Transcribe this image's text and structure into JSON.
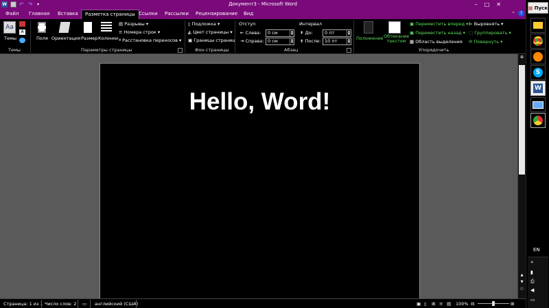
{
  "window": {
    "title": "Документ3 - Microsoft Word"
  },
  "tabs": [
    {
      "label": "Файл"
    },
    {
      "label": "Главная"
    },
    {
      "label": "Вставка"
    },
    {
      "label": "Разметка страницы",
      "active": true
    },
    {
      "label": "Ссылки"
    },
    {
      "label": "Рассылки"
    },
    {
      "label": "Рецензирование"
    },
    {
      "label": "Вид"
    }
  ],
  "ribbon": {
    "themes": {
      "themes_label": "Темы",
      "group_label": "Темы"
    },
    "page_setup": {
      "margins": "Поля",
      "orientation": "Ориентация",
      "size": "Размер",
      "columns": "Колонки",
      "breaks": "Разрывы",
      "line_numbers": "Номера строк",
      "hyphenation": "Расстановка переносов",
      "group_label": "Параметры страницы"
    },
    "page_background": {
      "watermark": "Подложка",
      "page_color": "Цвет страницы",
      "page_borders": "Границы страниц",
      "group_label": "Фон страницы"
    },
    "paragraph": {
      "indent_label": "Отступ",
      "left_label": "Слева:",
      "left_value": "0 см",
      "right_label": "Справа:",
      "right_value": "0 см",
      "spacing_label": "Интервал",
      "before_label": "До:",
      "before_value": "0 пт",
      "after_label": "После:",
      "after_value": "10 пт",
      "group_label": "Абзац"
    },
    "arrange": {
      "position": "Положение",
      "wrap_text_1": "Обтекание",
      "wrap_text_2": "текстом",
      "bring_forward": "Переместить вперед",
      "send_backward": "Переместить назад",
      "selection_pane": "Область выделения",
      "align": "Выровнять",
      "group": "Группировать",
      "rotate": "Повернуть",
      "group_label": "Упорядочить"
    }
  },
  "document": {
    "heading": "Hello, Word!"
  },
  "statusbar": {
    "page": "Страница: 1 из 1",
    "words": "Число слов: 2",
    "language": "английский (США)",
    "zoom": "100%"
  },
  "taskbar": {
    "start_label": "Пуск",
    "lang": "EN"
  },
  "colors": {
    "accent": "#7a0a7a",
    "green_text": "#5ee05e"
  }
}
